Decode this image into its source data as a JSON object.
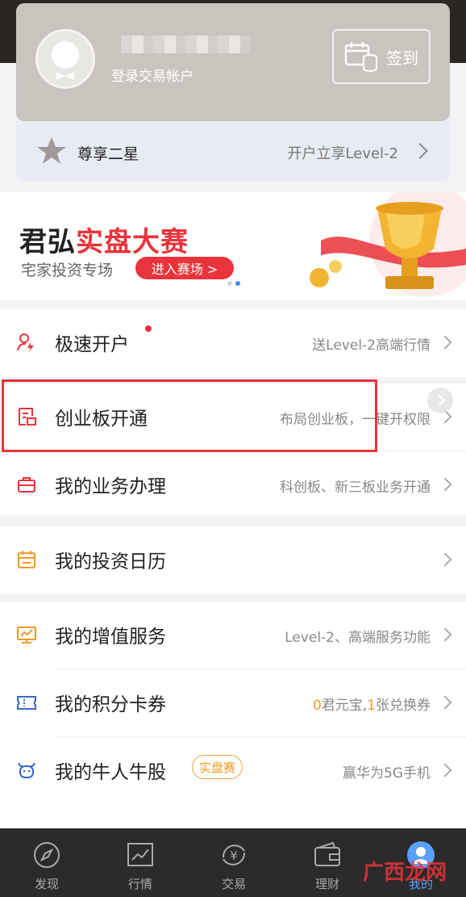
{
  "account": {
    "login_text": "登录交易帐户",
    "checkin_label": "签到"
  },
  "member": {
    "level": "尊享二星",
    "promo": "开户立享Level-2"
  },
  "banner": {
    "title_black": "君弘",
    "title_red": "实盘大赛",
    "subtitle": "宅家投资专场",
    "button": "进入赛场 >",
    "pages": 2,
    "current_page": 2
  },
  "menu": {
    "open_account": {
      "label": "极速开户",
      "extra": "送Level-2高端行情"
    },
    "chinext": {
      "label": "创业板开通",
      "extra": "布局创业板，一键开权限"
    },
    "business": {
      "label": "我的业务办理",
      "extra": "科创板、新三板业务开通"
    },
    "calendar": {
      "label": "我的投资日历",
      "extra": ""
    },
    "value_added": {
      "label": "我的增值服务",
      "extra": "Level-2、高端服务功能"
    },
    "points": {
      "label": "我的积分卡券",
      "extra_n1": "0",
      "extra_t1": "君元宝,",
      "extra_n2": "1",
      "extra_t2": "张兑换券"
    },
    "star_stock": {
      "label": "我的牛人牛股",
      "badge": "实盘赛",
      "extra": "赢华为5G手机"
    }
  },
  "tabs": [
    {
      "label": "发现"
    },
    {
      "label": "行情"
    },
    {
      "label": "交易"
    },
    {
      "label": "理财"
    },
    {
      "label": "我的"
    }
  ],
  "watermark": "广西龙网",
  "colors": {
    "accent_red": "#e8343a",
    "accent_orange": "#f09a23",
    "active_blue": "#5aa0ff"
  },
  "icons": [
    "calendar-coins-icon",
    "star-icon",
    "trophy-icon",
    "user-plus-icon",
    "chinext-icon",
    "briefcase-icon",
    "calendar-icon",
    "monitor-chart-icon",
    "ticket-icon",
    "bull-icon",
    "compass-icon",
    "chart-icon",
    "yen-icon",
    "wallet-icon",
    "user-avatar-icon"
  ]
}
